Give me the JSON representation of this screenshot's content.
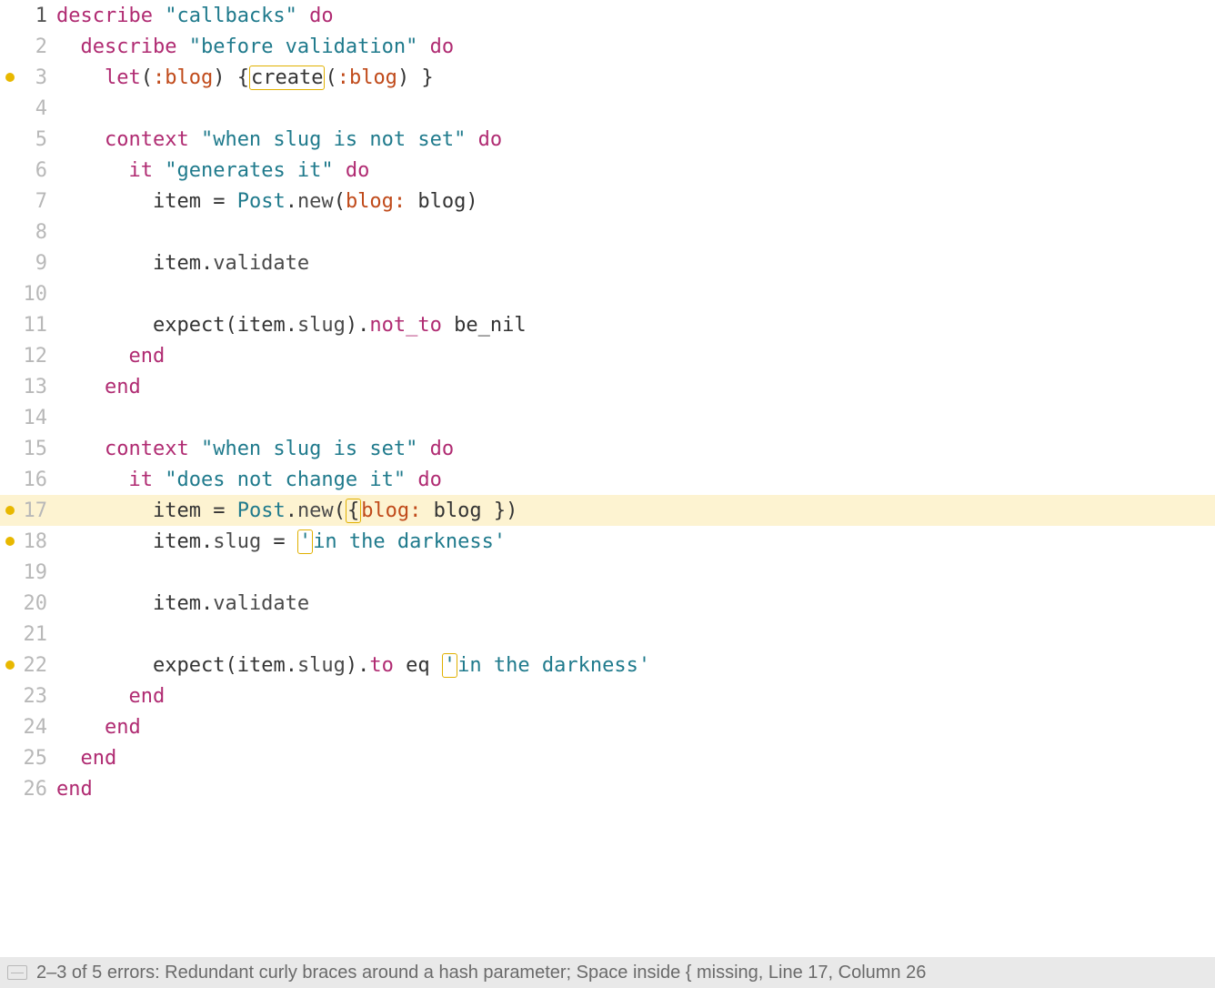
{
  "lines": [
    {
      "n": 1,
      "dot": false,
      "hl": false
    },
    {
      "n": 2,
      "dot": false,
      "hl": false
    },
    {
      "n": 3,
      "dot": true,
      "hl": false
    },
    {
      "n": 4,
      "dot": false,
      "hl": false
    },
    {
      "n": 5,
      "dot": false,
      "hl": false
    },
    {
      "n": 6,
      "dot": false,
      "hl": false
    },
    {
      "n": 7,
      "dot": false,
      "hl": false
    },
    {
      "n": 8,
      "dot": false,
      "hl": false
    },
    {
      "n": 9,
      "dot": false,
      "hl": false
    },
    {
      "n": 10,
      "dot": false,
      "hl": false
    },
    {
      "n": 11,
      "dot": false,
      "hl": false
    },
    {
      "n": 12,
      "dot": false,
      "hl": false
    },
    {
      "n": 13,
      "dot": false,
      "hl": false
    },
    {
      "n": 14,
      "dot": false,
      "hl": false
    },
    {
      "n": 15,
      "dot": false,
      "hl": false
    },
    {
      "n": 16,
      "dot": false,
      "hl": false
    },
    {
      "n": 17,
      "dot": true,
      "hl": true
    },
    {
      "n": 18,
      "dot": true,
      "hl": false
    },
    {
      "n": 19,
      "dot": false,
      "hl": false
    },
    {
      "n": 20,
      "dot": false,
      "hl": false
    },
    {
      "n": 21,
      "dot": false,
      "hl": false
    },
    {
      "n": 22,
      "dot": true,
      "hl": false
    },
    {
      "n": 23,
      "dot": false,
      "hl": false
    },
    {
      "n": 24,
      "dot": false,
      "hl": false
    },
    {
      "n": 25,
      "dot": false,
      "hl": false
    },
    {
      "n": 26,
      "dot": false,
      "hl": false
    }
  ],
  "tok": {
    "describe": "describe",
    "do": "do",
    "end": "end",
    "let": "let",
    "context": "context",
    "it": "it",
    "expect": "expect",
    "not_to": "not_to",
    "to": "to",
    "eq": "eq",
    "be_nil": "be_nil",
    "create": "create",
    "Post": "Post",
    "new": "new",
    "validate": "validate",
    "slug": "slug",
    "item": "item",
    "blog_var": "blog",
    "blog_key": "blog:"
  },
  "str": {
    "callbacks": "\"callbacks\"",
    "before_validation": "\"before validation\"",
    "when_not_set": "\"when slug is not set\"",
    "generates": "\"generates it\"",
    "when_set": "\"when slug is set\"",
    "does_not_change": "\"does not change it\"",
    "darkness": "in the darkness",
    "sq": "'"
  },
  "sym": {
    "blog": ":blog"
  },
  "status": "2–3 of 5 errors: Redundant curly braces around a hash parameter; Space inside { missing, Line 17, Column 26"
}
